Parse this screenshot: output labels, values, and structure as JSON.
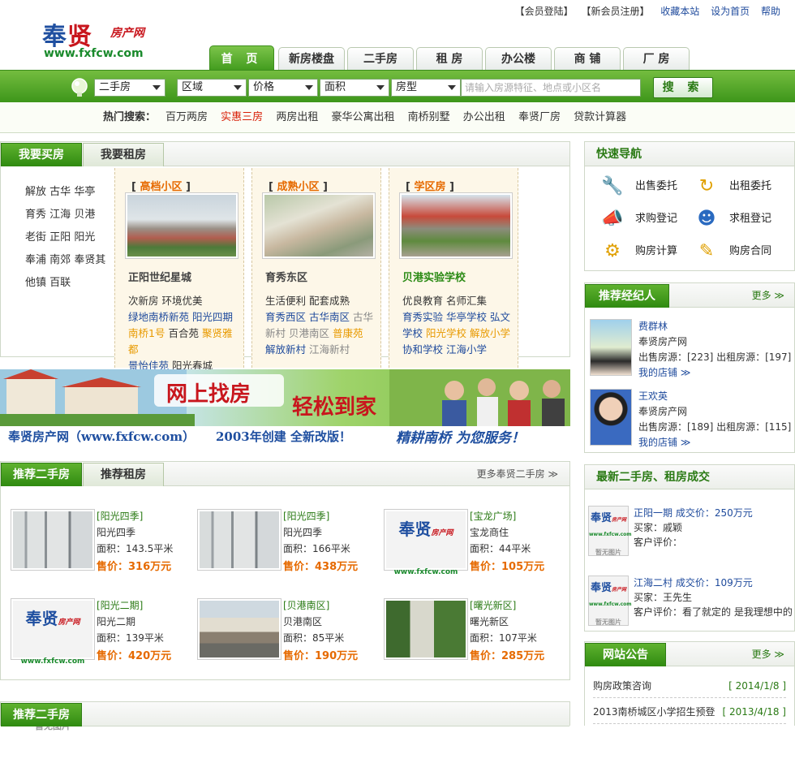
{
  "top_links": {
    "login": "【会员登陆】",
    "register": "【新会员注册】",
    "favorite": "收藏本站",
    "homepage": "设为首页",
    "help": "帮助"
  },
  "logo": {
    "chars": "奉贤",
    "suffix": "房产网",
    "url": "www.fxfcw.com"
  },
  "nav_tabs": [
    "首 页",
    "新房楼盘",
    "二手房",
    "租 房",
    "办公楼",
    "商 铺",
    "厂 房"
  ],
  "search": {
    "type": "二手房",
    "area": "区域",
    "price": "价格",
    "size": "面积",
    "room": "房型",
    "placeholder": "请输入房源特征、地点或小区名",
    "button": "搜 索"
  },
  "hot": {
    "label": "热门搜索：",
    "items": [
      "百万两房",
      "实惠三房",
      "两房出租",
      "豪华公寓出租",
      "南桥别墅",
      "办公出租",
      "奉贤厂房",
      "贷款计算器"
    ]
  },
  "buy_panel": {
    "tabs": [
      "我要买房",
      "我要租房"
    ],
    "areas": [
      [
        "解放",
        "古华",
        "华亭"
      ],
      [
        "育秀",
        "江海",
        "贝港"
      ],
      [
        "老街",
        "正阳",
        "阳光"
      ],
      [
        "奉浦",
        "南郊",
        "奉贤其"
      ],
      [
        "他镇",
        "百联"
      ]
    ],
    "categories": [
      {
        "title": "高档小区",
        "name": "正阳世纪星城",
        "lines": [
          [
            {
              "t": "次新房",
              "c": "k"
            },
            {
              "t": "环境优美",
              "c": "k"
            }
          ],
          [
            {
              "t": "绿地南桥新苑",
              "c": "b"
            },
            {
              "t": "阳光四期",
              "c": "b"
            }
          ],
          [
            {
              "t": "南桥1号",
              "c": "o"
            },
            {
              "t": "百合苑",
              "c": "k"
            },
            {
              "t": "聚贤雅都",
              "c": "o"
            }
          ],
          [
            {
              "t": "景怡佳苑",
              "c": "b"
            },
            {
              "t": "阳光春城",
              "c": "k"
            }
          ]
        ]
      },
      {
        "title": "成熟小区",
        "name": "育秀东区",
        "lines": [
          [
            {
              "t": "生活便利",
              "c": "k"
            },
            {
              "t": "配套成熟",
              "c": "k"
            }
          ],
          [
            {
              "t": "育秀西区",
              "c": "b"
            },
            {
              "t": "古华南区",
              "c": "b"
            },
            {
              "t": "古华",
              "c": "gr"
            }
          ],
          [
            {
              "t": "新村",
              "c": "gr"
            },
            {
              "t": "贝港南区",
              "c": "gr"
            },
            {
              "t": "普康苑",
              "c": "o"
            }
          ],
          [
            {
              "t": "解放新村",
              "c": "b"
            },
            {
              "t": "江海新村",
              "c": "gr"
            }
          ]
        ]
      },
      {
        "title": "学区房",
        "name": "贝港实验学校",
        "lines": [
          [
            {
              "t": "优良教育",
              "c": "k"
            },
            {
              "t": "名师汇集",
              "c": "k"
            }
          ],
          [
            {
              "t": "育秀实验",
              "c": "b"
            },
            {
              "t": "华亭学校",
              "c": "b"
            },
            {
              "t": "弘文",
              "c": "b"
            }
          ],
          [
            {
              "t": "学校",
              "c": "b"
            },
            {
              "t": "阳光学校",
              "c": "o"
            },
            {
              "t": "解放小学",
              "c": "o"
            }
          ],
          [
            {
              "t": "协和学校",
              "c": "b"
            },
            {
              "t": "江海小学",
              "c": "b"
            }
          ]
        ]
      }
    ]
  },
  "banner": {
    "slogan1": "网上找房",
    "slogan2": "轻松到家",
    "footer_left": "奉贤房产网（www.fxfcw.com）",
    "footer_mid": "2003年创建  全新改版！",
    "footer_right": "精耕南桥  为您服务！"
  },
  "listings_panel": {
    "tabs": [
      "推荐二手房",
      "推荐租房"
    ],
    "more": "更多奉贤二手房",
    "items": [
      {
        "tag": "[阳光四季]",
        "name": "阳光四季",
        "area": "面积：143.5平米",
        "price": "售价：316万元",
        "img": "building"
      },
      {
        "tag": "[阳光四季]",
        "name": "阳光四季",
        "area": "面积：166平米",
        "price": "售价：438万元",
        "img": "building"
      },
      {
        "tag": "[宝龙广场]",
        "name": "宝龙商住",
        "area": "面积：44平米",
        "price": "售价：105万元",
        "img": "none"
      },
      {
        "tag": "[阳光二期]",
        "name": "阳光二期",
        "area": "面积：139平米",
        "price": "售价：420万元",
        "img": "none"
      },
      {
        "tag": "[贝港南区]",
        "name": "贝港南区",
        "area": "面积：85平米",
        "price": "售价：190万元",
        "img": "street"
      },
      {
        "tag": "[曙光新区]",
        "name": "曙光新区",
        "area": "面积：107平米",
        "price": "售价：285万元",
        "img": "trees"
      }
    ],
    "noimg": {
      "l1": "奉贤",
      "l1s": "房产网",
      "l2": "www.fxfcw.com",
      "l3": "暂无图片"
    }
  },
  "bottom_tab": "推荐二手房",
  "quick_nav": {
    "title": "快速导航",
    "items": [
      {
        "label": "出售委托",
        "icon": "wrench-icon",
        "glyph": "🔧"
      },
      {
        "label": "出租委托",
        "icon": "refresh-icon",
        "glyph": "↻"
      },
      {
        "label": "求购登记",
        "icon": "megaphone-icon",
        "glyph": "📣"
      },
      {
        "label": "求租登记",
        "icon": "person-icon",
        "glyph": "☻"
      },
      {
        "label": "购房计算",
        "icon": "gear-icon",
        "glyph": "⚙"
      },
      {
        "label": "购房合同",
        "icon": "pencil-icon",
        "glyph": "✎"
      }
    ]
  },
  "agents": {
    "title": "推荐经纪人",
    "more": "更多 ≫",
    "items": [
      {
        "name": "费群林",
        "company": "奉贤房产网",
        "stats": "出售房源：[223]  出租房源：[197]",
        "link": "我的店铺 ≫"
      },
      {
        "name": "王欢英",
        "company": "奉贤房产网",
        "stats": "出售房源：[189]  出租房源：[115]",
        "link": "我的店铺 ≫"
      }
    ]
  },
  "deals": {
    "title": "最新二手房、租房成交",
    "items": [
      {
        "title": "正阳一期  成交价：250万元",
        "buyer": "买家：戚颖",
        "review": "客户评价："
      },
      {
        "title": "江海二村  成交价：109万元",
        "buyer": "买家：王先生",
        "review": "客户评价：看了就定的 是我理想中的"
      }
    ]
  },
  "notices": {
    "title": "网站公告",
    "more": "更多 ≫",
    "items": [
      {
        "text": "购房政策咨询",
        "date": "[ 2014/1/8 ]"
      },
      {
        "text": "2013南桥城区小学招生预登",
        "date": "[ 2013/4/18 ]"
      }
    ]
  },
  "colors": {
    "green": "#3d961a",
    "accent_orange": "#e66a00",
    "link_blue": "#1e4a9c",
    "red": "#d81e06"
  }
}
